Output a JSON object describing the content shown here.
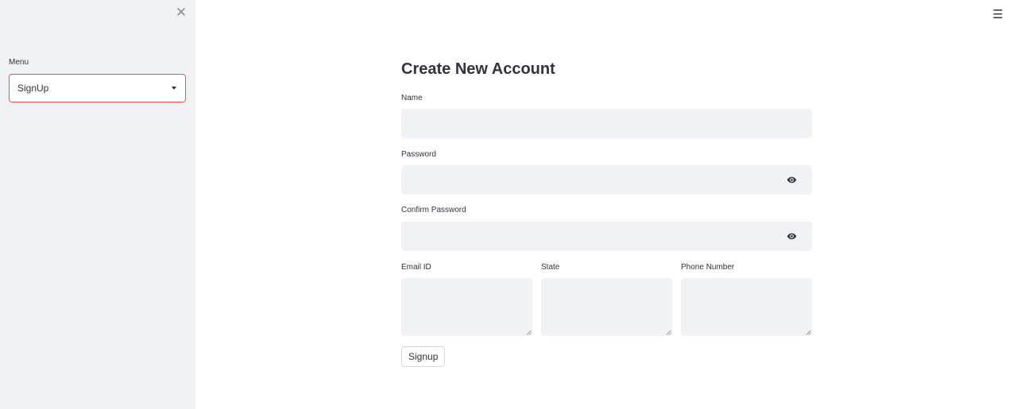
{
  "sidebar": {
    "close_icon": "close-icon",
    "menu_label": "Menu",
    "menu_selected": "SignUp",
    "accent_color": "#ff4b4b",
    "background": "#f0f2f6"
  },
  "header": {
    "menu_icon": "hamburger-icon",
    "menu_glyph": "☰"
  },
  "form": {
    "title": "Create New Account",
    "name_label": "Name",
    "name_value": "",
    "password_label": "Password",
    "password_value": "",
    "confirm_password_label": "Confirm Password",
    "confirm_password_value": "",
    "email_label": "Email ID",
    "email_value": "",
    "state_label": "State",
    "state_value": "",
    "phone_label": "Phone Number",
    "phone_value": "",
    "submit_label": "Signup"
  }
}
